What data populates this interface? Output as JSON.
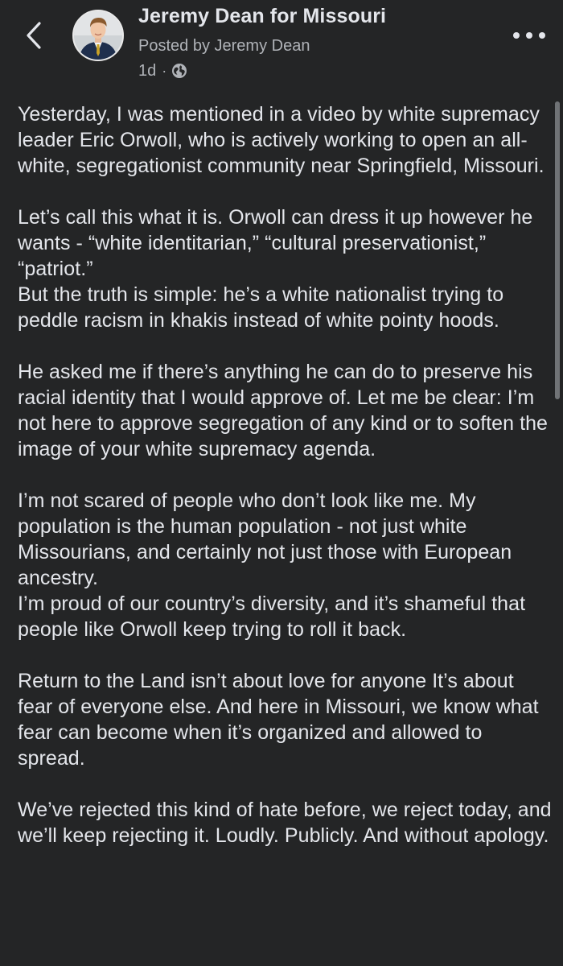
{
  "header": {
    "page_name": "Jeremy Dean for Missouri",
    "posted_by": "Posted by Jeremy Dean",
    "time_ago": "1d",
    "separator": "·",
    "privacy_icon": "globe-icon",
    "back_icon": "chevron-left-icon",
    "more_icon": "more-dots-icon"
  },
  "post": {
    "paragraphs": [
      "Yesterday, I was mentioned in a video by white supremacy leader Eric Orwoll, who is actively working to open an all-white, segregationist community near Springfield, Missouri.",
      "Let’s call this what it is. Orwoll can dress it up however he wants - “white identitarian,” “cultural preservationist,” “patriot.”\nBut the truth is simple: he’s a white nationalist trying to peddle racism in khakis instead of white pointy hoods.",
      "He asked me if there’s anything he can do to preserve his racial identity that I would approve of. Let me be clear: I’m not here to approve segregation of any kind or to soften the image of your white supremacy agenda.",
      "I’m not scared of people who don’t look like me. My population is the human population - not just white Missourians, and certainly not just those with European ancestry.\nI’m proud of our country’s diversity, and it’s shameful that people like Orwoll keep trying to roll it back.",
      "Return to the Land isn’t about love for anyone  It’s about fear of everyone else. And here in Missouri, we know what fear can become when it’s organized and allowed to spread.",
      "We’ve rejected this kind of hate before, we reject today, and we’ll keep rejecting it. Loudly. Publicly. And without apology."
    ]
  },
  "colors": {
    "background": "#242526",
    "primary_text": "#e4e6eb",
    "secondary_text": "#b0b3b8"
  }
}
